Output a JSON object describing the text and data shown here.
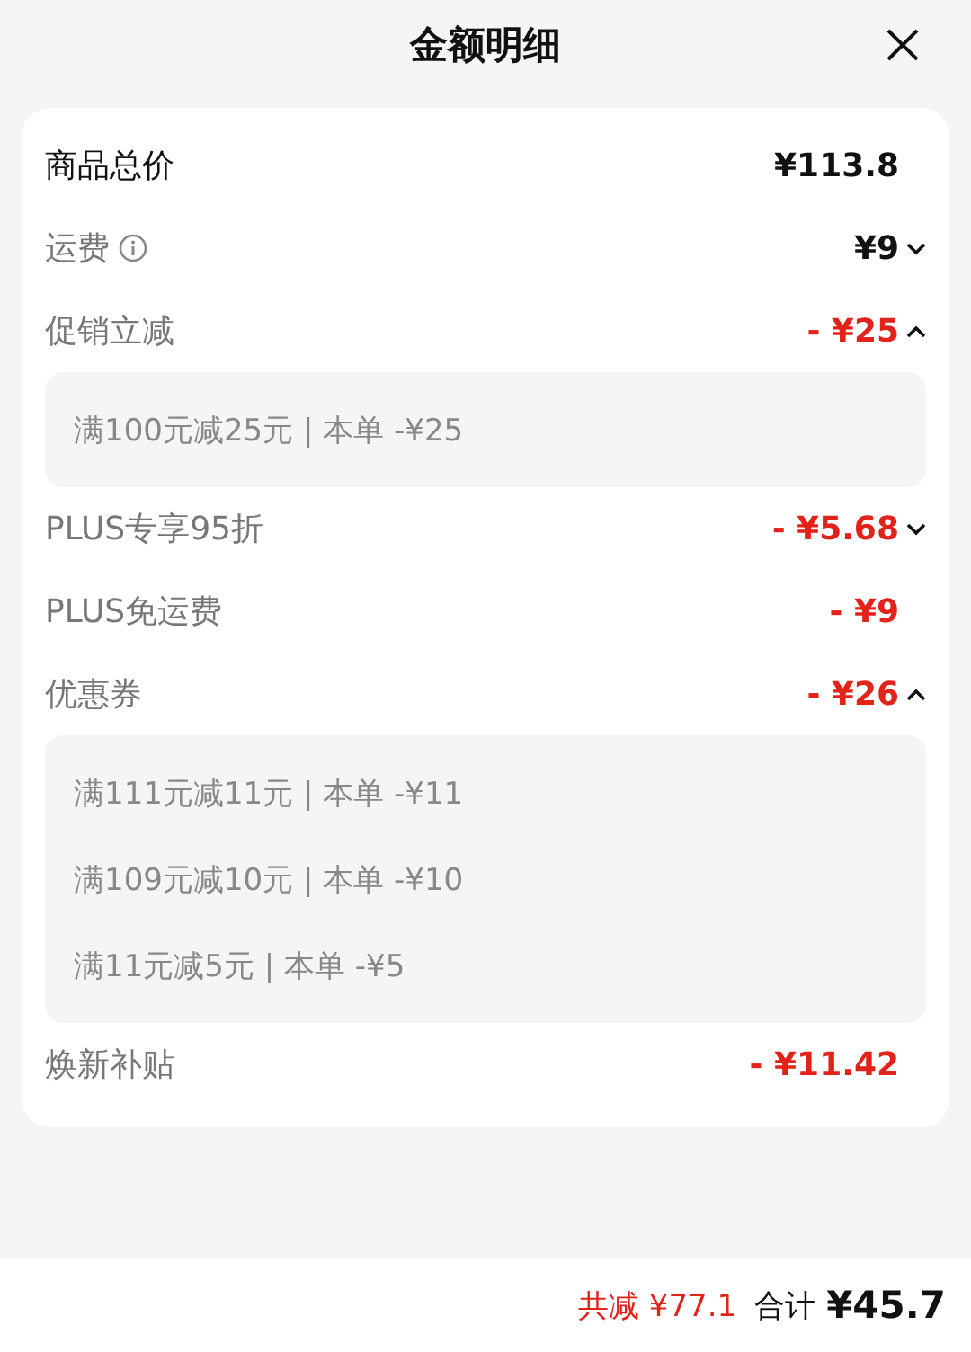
{
  "header": {
    "title": "金额明细"
  },
  "rows": [
    {
      "label": "商品总价",
      "amount": "¥113.8",
      "kind": "total"
    },
    {
      "label": "运费",
      "amount": "¥9",
      "kind": "neutral",
      "info": true,
      "expanded": false
    },
    {
      "label": "促销立减",
      "amount": "- ¥25",
      "kind": "discount",
      "expanded": true,
      "details": [
        "满100元减25元 | 本单 -¥25"
      ]
    },
    {
      "label": "PLUS专享95折",
      "amount": "- ¥5.68",
      "kind": "discount",
      "expanded": false
    },
    {
      "label": "PLUS免运费",
      "amount": "- ¥9",
      "kind": "discount"
    },
    {
      "label": "优惠券",
      "amount": "- ¥26",
      "kind": "discount",
      "expanded": true,
      "details": [
        "满111元减11元 | 本单 -¥11",
        "满109元减10元 | 本单 -¥10",
        "满11元减5元 | 本单 -¥5"
      ]
    },
    {
      "label": "焕新补贴",
      "amount": "- ¥11.42",
      "kind": "discount"
    }
  ],
  "footer": {
    "saved": "共减 ¥77.1",
    "total_label": "合计",
    "total": "¥45.7"
  }
}
